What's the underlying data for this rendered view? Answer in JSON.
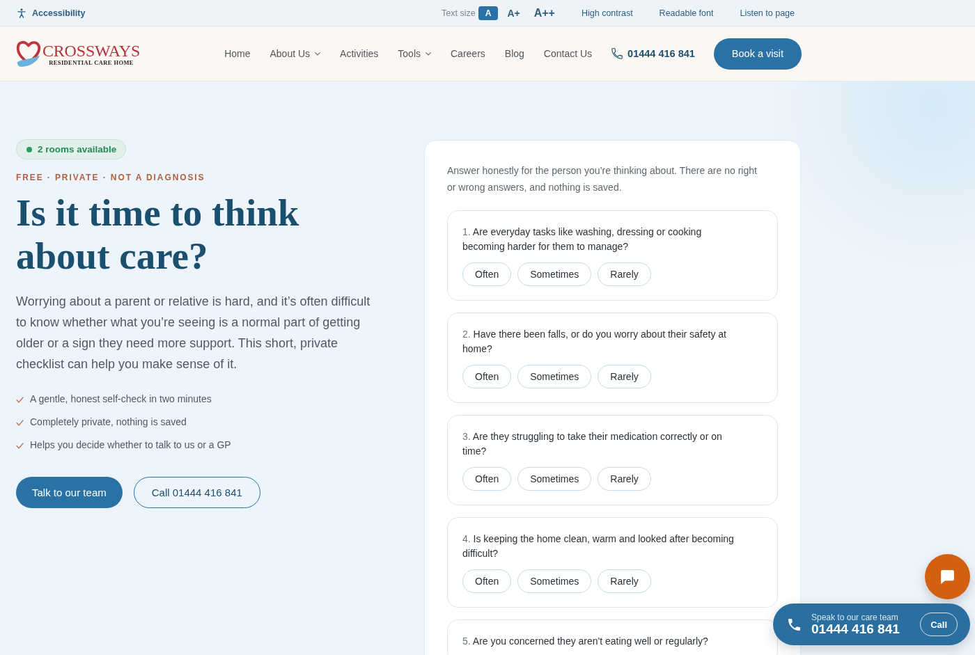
{
  "accessibility_bar": {
    "title": "Accessibility",
    "text_size": {
      "label": "Text size",
      "options": [
        {
          "label": "A",
          "selected": true
        },
        {
          "label": "A+",
          "selected": false
        },
        {
          "label": "A++",
          "selected": false
        }
      ]
    },
    "tools": [
      "High contrast",
      "Readable font",
      "Listen to page"
    ]
  },
  "header": {
    "logo": {
      "name": "CROSSWAYS",
      "tagline": "RESIDENTIAL CARE HOME"
    },
    "nav": [
      {
        "label": "Home",
        "kind": "link"
      },
      {
        "label": "About Us",
        "kind": "dropdown"
      },
      {
        "label": "Activities",
        "kind": "link"
      },
      {
        "label": "Tools",
        "kind": "dropdown"
      },
      {
        "label": "Careers",
        "kind": "link"
      },
      {
        "label": "Blog",
        "kind": "link"
      },
      {
        "label": "Contact Us",
        "kind": "link"
      }
    ],
    "phone": "01444 416 841",
    "cta": "Book a visit"
  },
  "hero": {
    "badge": "2 rooms available",
    "eyebrow": "FREE · PRIVATE · NOT A DIAGNOSIS",
    "title": "Is it time to think about care?",
    "intro": "Worrying about a parent or relative is hard, and it’s often difficult to know whether what you’re seeing is a normal part of getting older or a sign they need more support. This short, private checklist can help you make sense of it.",
    "points": [
      "A gentle, honest self-check in two minutes",
      "Completely private, nothing is saved",
      "Helps you decide whether to talk to us or a GP"
    ],
    "buttons": [
      {
        "label": "Talk to our team",
        "kind": "primary"
      },
      {
        "label": "Call 01444 416 841",
        "kind": "secondary"
      }
    ]
  },
  "checklist": {
    "intro": "Answer honestly for the person you’re thinking about. There are no right or wrong answers, and nothing is saved.",
    "questions": [
      {
        "number": "1.",
        "text": "Are everyday tasks like washing, dressing or cooking becoming harder for them to manage?",
        "options": [
          {
            "label": "Often",
            "selected": false
          },
          {
            "label": "Sometimes",
            "selected": false
          },
          {
            "label": "Rarely",
            "selected": false
          }
        ]
      },
      {
        "number": "2.",
        "text": "Have there been falls, or do you worry about their safety at home?",
        "options": [
          {
            "label": "Often",
            "selected": false
          },
          {
            "label": "Sometimes",
            "selected": false
          },
          {
            "label": "Rarely",
            "selected": false
          }
        ]
      },
      {
        "number": "3.",
        "text": "Are they struggling to take their medication correctly or on time?",
        "options": [
          {
            "label": "Often",
            "selected": false
          },
          {
            "label": "Sometimes",
            "selected": false
          },
          {
            "label": "Rarely",
            "selected": false
          }
        ]
      },
      {
        "number": "4.",
        "text": "Is keeping the home clean, warm and looked after becoming difficult?",
        "options": [
          {
            "label": "Often",
            "selected": false
          },
          {
            "label": "Sometimes",
            "selected": false
          },
          {
            "label": "Rarely",
            "selected": false
          }
        ]
      },
      {
        "number": "5.",
        "text": "Are you concerned they aren't eating well or regularly?"
      }
    ]
  },
  "call_bar": {
    "caption": "Speak to our care team",
    "phone": "01444 416 841",
    "button": "Call"
  }
}
